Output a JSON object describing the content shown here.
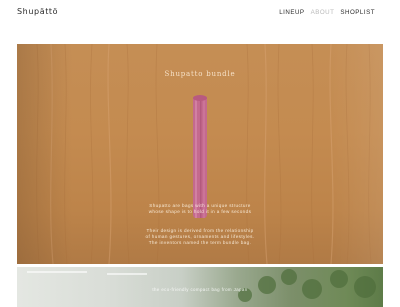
{
  "header": {
    "logo": "Shupättö",
    "nav": [
      {
        "label": "LINEUP"
      },
      {
        "label": "ABOUT"
      },
      {
        "label": "SHOPLIST"
      }
    ]
  },
  "hero": {
    "title": "Shupatto bundle",
    "caption_1": [
      "Shupatto are bags with a unique structure",
      "whose shape is to hold it in a few seconds"
    ],
    "caption_2": [
      "Their design is derived from the relationship",
      "of human gestures, ornaments and lifestyles.",
      "The inventors named the term bundle bag."
    ]
  },
  "band": {
    "text": "the eco-friendly compact bag from Japan"
  },
  "colors": {
    "wood": "#c48b50",
    "bag": "#c46a8e",
    "nav_active": "#b9b9b9"
  }
}
